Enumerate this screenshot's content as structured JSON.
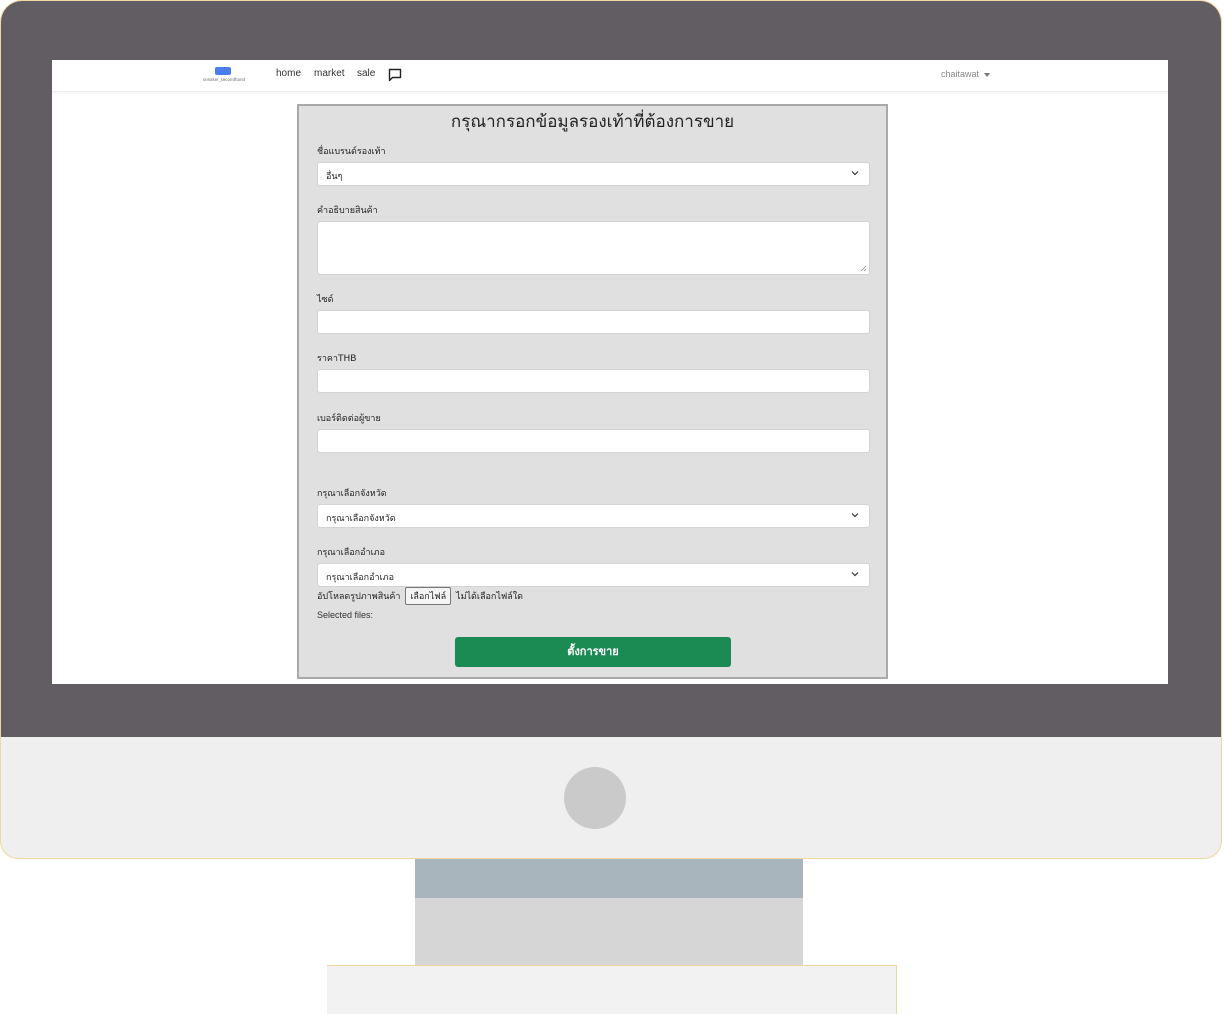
{
  "navbar": {
    "brand_text": "sneaker_secondhand",
    "links": [
      "home",
      "market",
      "sale"
    ],
    "user": "chaitawat"
  },
  "form": {
    "title": "กรุณากรอกข้อมูลรองเท้าที่ต้องการขาย",
    "brand_label": "ชื่อแบรนด์รองเท้า",
    "brand_value": "อื่นๆ",
    "description_label": "คำอธิบายสินค้า",
    "description_value": "",
    "size_label": "ไซด์",
    "size_value": "",
    "price_label": "ราคาTHB",
    "price_value": "",
    "phone_label": "เบอร์ติดต่อผู้ขาย",
    "phone_value": "",
    "province_label": "กรุณาเลือกจังหวัด",
    "province_value": "กรุณาเลือกจังหวัด",
    "district_label": "กรุณาเลือกอำเภอ",
    "district_value": "กรุณาเลือกอำเภอ",
    "upload_label": "อัปโหลดรูปภาพสินค้า",
    "choose_file_button": "เลือกไฟล์",
    "no_file_text": "ไม่ได้เลือกไฟล์ใด",
    "selected_files_label": "Selected files:",
    "submit_label": "ตั้งการขาย"
  },
  "colors": {
    "submit": "#1b8a53",
    "card_bg": "#e0e0e0",
    "monitor_bezel": "#625d63"
  },
  "icons": [
    "chat-icon",
    "chevron-down-icon",
    "caret-down-icon"
  ]
}
